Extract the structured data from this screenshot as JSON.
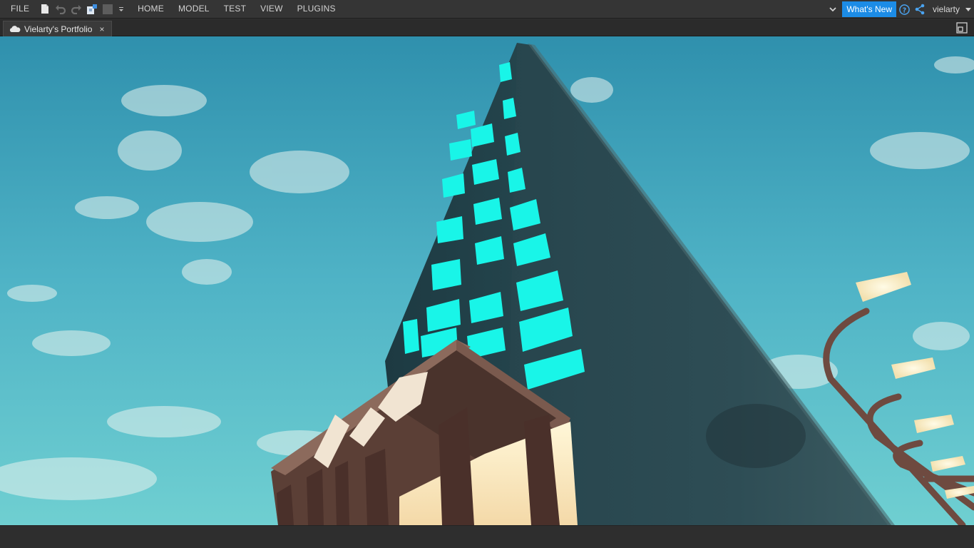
{
  "menu": {
    "file": "FILE",
    "tabs": [
      "HOME",
      "MODEL",
      "TEST",
      "VIEW",
      "PLUGINS"
    ]
  },
  "quick_access": [
    {
      "icon": "new-file-icon"
    },
    {
      "icon": "undo-icon"
    },
    {
      "icon": "redo-icon"
    },
    {
      "icon": "plugin-puzzle-icon"
    },
    {
      "icon": "stop-square-icon"
    },
    {
      "icon": "dropdown-arrow-icon"
    }
  ],
  "header_right": {
    "whats_new": "What's New",
    "username": "vielarty"
  },
  "document_tab": {
    "title": "Vielarty's Portfolio",
    "close": "×"
  },
  "colors": {
    "accent": "#1c8ce6",
    "sky": "#4fb3c6",
    "window_glow": "#19f5e8"
  }
}
